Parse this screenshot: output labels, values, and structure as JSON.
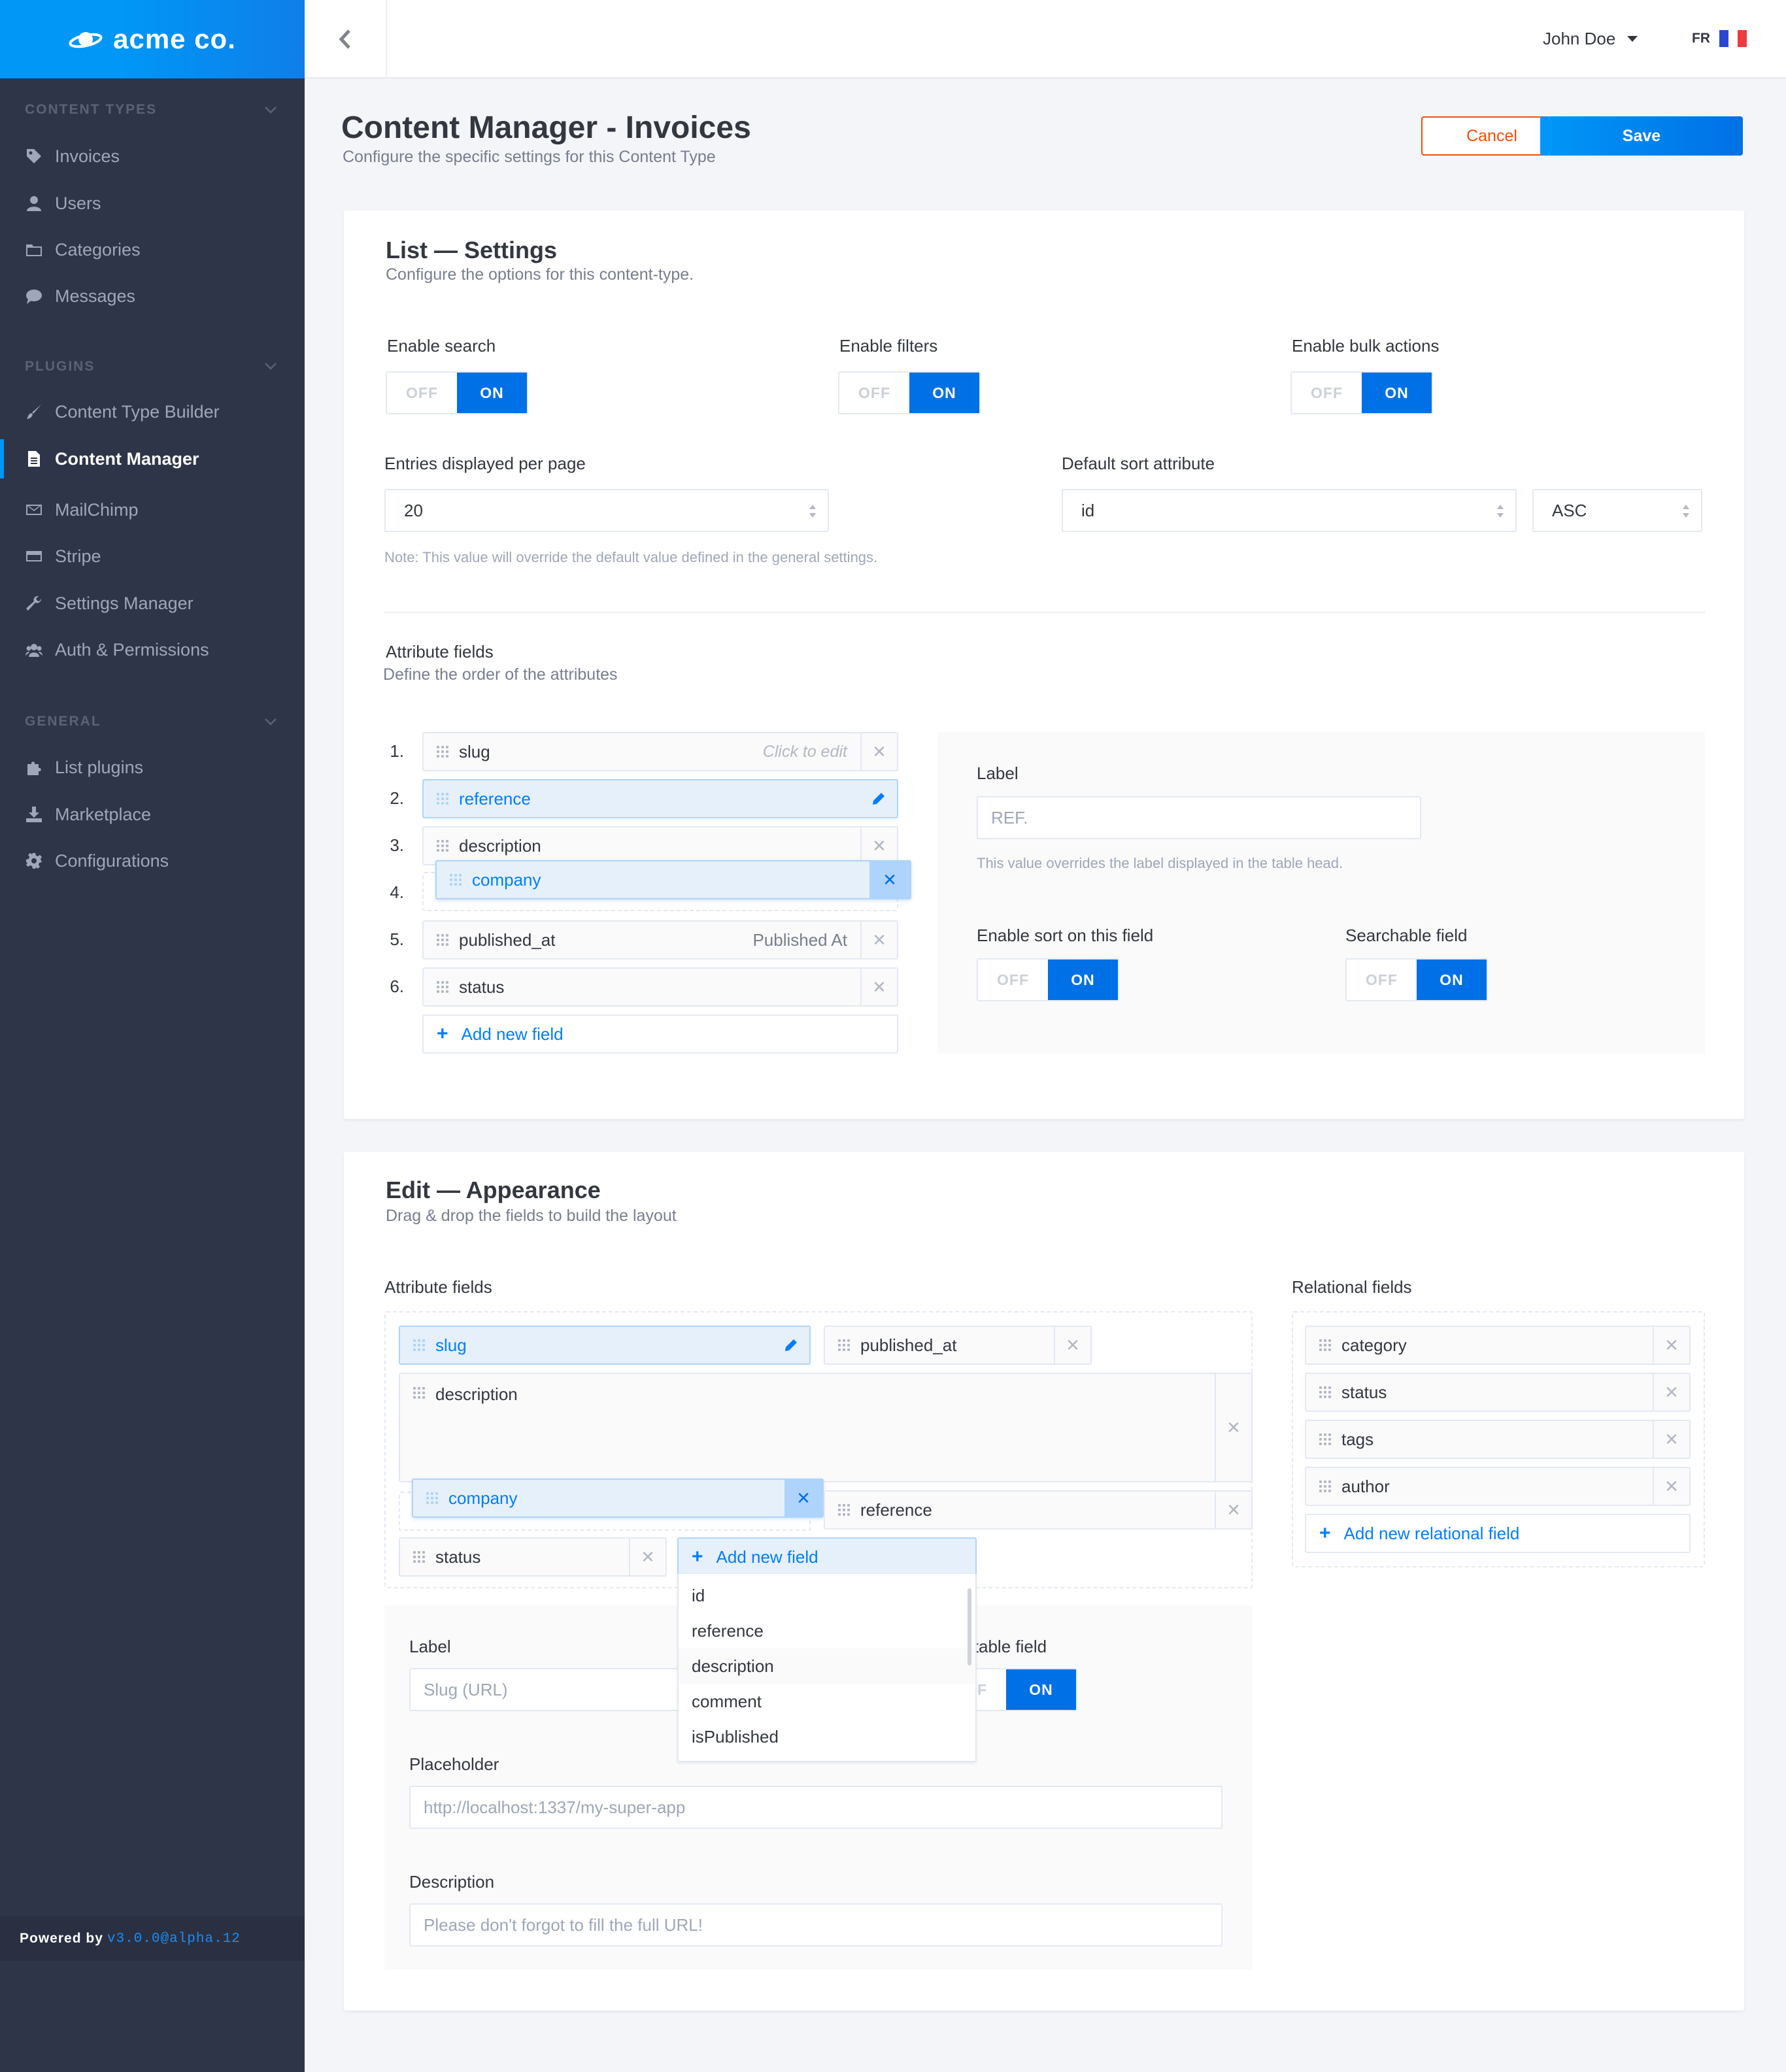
{
  "brand": {
    "name": "acme co."
  },
  "sidebar": {
    "sections": [
      {
        "title": "CONTENT TYPES",
        "items": [
          {
            "label": "Invoices",
            "icon": "tag-icon"
          },
          {
            "label": "Users",
            "icon": "user-icon"
          },
          {
            "label": "Categories",
            "icon": "folder-icon"
          },
          {
            "label": "Messages",
            "icon": "comment-icon"
          }
        ]
      },
      {
        "title": "PLUGINS",
        "items": [
          {
            "label": "Content Type Builder",
            "icon": "brush-icon"
          },
          {
            "label": "Content Manager",
            "icon": "document-icon",
            "active": true
          },
          {
            "label": "MailChimp",
            "icon": "envelope-icon"
          },
          {
            "label": "Stripe",
            "icon": "credit-card-icon"
          },
          {
            "label": "Settings Manager",
            "icon": "wrench-icon"
          },
          {
            "label": "Auth & Permissions",
            "icon": "users-icon"
          }
        ]
      },
      {
        "title": "GENERAL",
        "items": [
          {
            "label": "List plugins",
            "icon": "puzzle-icon"
          },
          {
            "label": "Marketplace",
            "icon": "download-icon"
          },
          {
            "label": "Configurations",
            "icon": "gear-icon"
          }
        ]
      }
    ],
    "powered_by": "Powered by",
    "version": "v3.0.0@alpha.12"
  },
  "topbar": {
    "user": "John Doe",
    "lang": "FR"
  },
  "header": {
    "title": "Content Manager - Invoices",
    "subtitle": "Configure the specific settings for this Content Type",
    "cancel": "Cancel",
    "save": "Save"
  },
  "list_settings": {
    "title": "List — Settings",
    "subtitle": "Configure the options for this content-type.",
    "toggles": [
      {
        "label": "Enable search",
        "off": "OFF",
        "on": "ON",
        "value": "on"
      },
      {
        "label": "Enable filters",
        "off": "OFF",
        "on": "ON",
        "value": "on"
      },
      {
        "label": "Enable bulk actions",
        "off": "OFF",
        "on": "ON",
        "value": "on"
      }
    ],
    "entries_label": "Entries displayed per page",
    "entries_value": "20",
    "note": "Note: This value will override the default value defined in the general settings.",
    "sort_label": "Default sort attribute",
    "sort_value": "id",
    "sort_order": "ASC",
    "attr_title": "Attribute fields",
    "attr_sub": "Define the order of the attributes",
    "fields": [
      {
        "num": "1.",
        "name": "slug",
        "hint": "Click to edit"
      },
      {
        "num": "2.",
        "name": "reference"
      },
      {
        "num": "3.",
        "name": "description"
      },
      {
        "num": "4.",
        "name": "company"
      },
      {
        "num": "5.",
        "name": "published_at",
        "alt": "Published At"
      },
      {
        "num": "6.",
        "name": "status"
      }
    ],
    "add_field": "Add new field",
    "detail": {
      "label_title": "Label",
      "label_placeholder": "REF.",
      "label_note": "This value overrides the label displayed in the table head.",
      "sort_label": "Enable sort on this field",
      "search_label": "Searchable field",
      "off": "OFF",
      "on": "ON"
    }
  },
  "edit_appearance": {
    "title": "Edit — Appearance",
    "subtitle": "Drag & drop the fields to build the layout",
    "attr_title": "Attribute fields",
    "rel_title": "Relational fields",
    "fields": {
      "slug": "slug",
      "published_at": "published_at",
      "description": "description",
      "company": "company",
      "reference": "reference",
      "status": "status"
    },
    "add_field": "Add new field",
    "dropdown": [
      "id",
      "reference",
      "description",
      "comment",
      "isPublished"
    ],
    "relations": [
      "category",
      "status",
      "tags",
      "author"
    ],
    "add_relation": "Add new relational field",
    "detail": {
      "label_title": "Label",
      "label_placeholder": "Slug (URL)",
      "editable_label": "itable field",
      "off": "OFF",
      "on": "ON",
      "placeholder_title": "Placeholder",
      "placeholder_value": "http://localhost:1337/my-super-app",
      "description_title": "Description",
      "description_value": "Please don't forgot to fill the full URL!"
    }
  },
  "colors": {
    "accent": "#0070e6",
    "brand": "#0097f7",
    "cancel": "#f64d0a",
    "sidebar": "#2e3548"
  }
}
